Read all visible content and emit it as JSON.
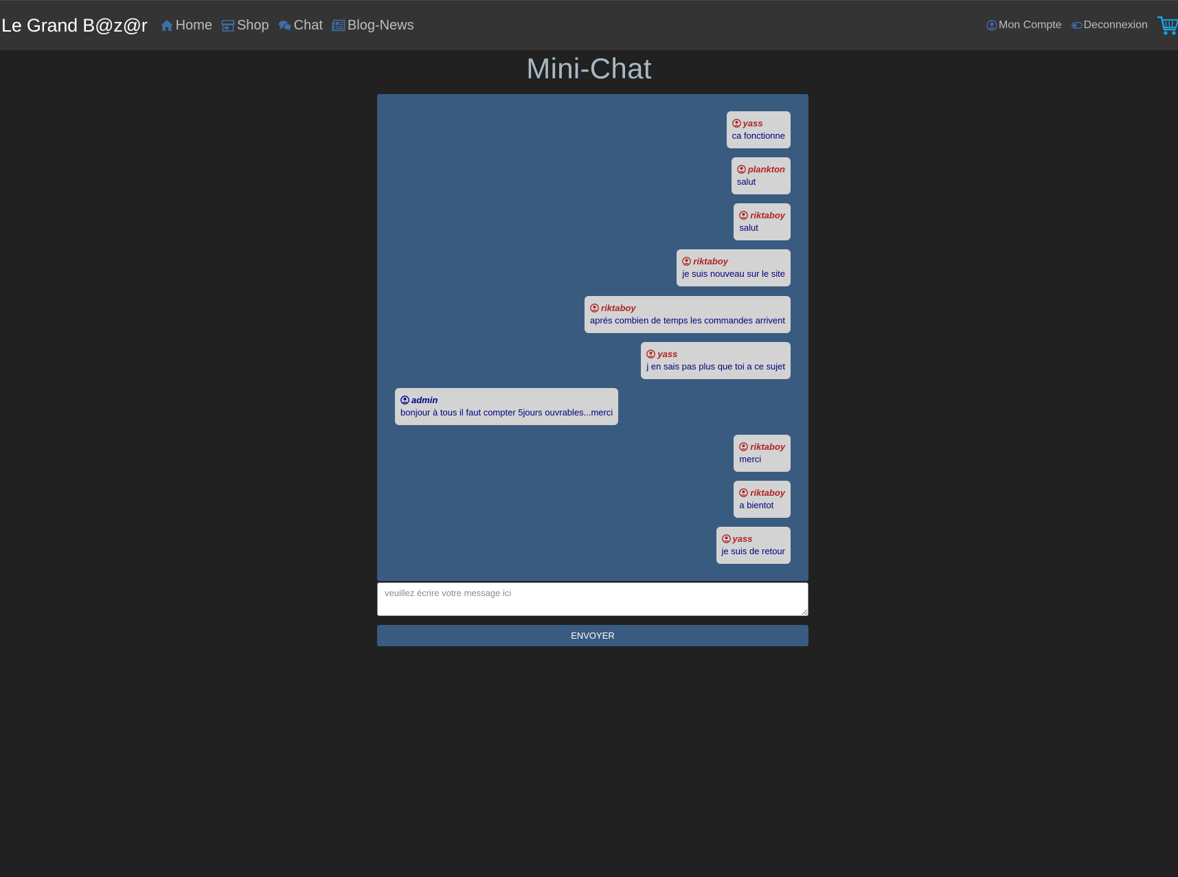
{
  "navbar": {
    "brand": "Le Grand B@z@r",
    "links": [
      {
        "label": "Home",
        "icon": "home-icon"
      },
      {
        "label": "Shop",
        "icon": "store-icon"
      },
      {
        "label": "Chat",
        "icon": "comments-icon"
      },
      {
        "label": "Blog-News",
        "icon": "newspaper-icon"
      }
    ],
    "account_label": "Mon Compte",
    "logout_label": "Deconnexion",
    "cart_icon": "cart-icon"
  },
  "page": {
    "title": "Mini-Chat"
  },
  "messages": [
    {
      "user": "yass",
      "text": "ca fonctionne",
      "side": "right"
    },
    {
      "user": "plankton",
      "text": "salut",
      "side": "right"
    },
    {
      "user": "riktaboy",
      "text": "salut",
      "side": "right"
    },
    {
      "user": "riktaboy",
      "text": "je suis nouveau sur le site",
      "side": "right"
    },
    {
      "user": "riktaboy",
      "text": "aprés combien de temps les commandes arrivent",
      "side": "right"
    },
    {
      "user": "yass",
      "text": "j en sais pas plus que toi a ce sujet",
      "side": "right"
    },
    {
      "user": "admin",
      "text": "bonjour à tous il faut compter 5jours ouvrables...merci",
      "side": "left"
    },
    {
      "user": "riktaboy",
      "text": "merci",
      "side": "right"
    },
    {
      "user": "riktaboy",
      "text": "a bientot",
      "side": "right"
    },
    {
      "user": "yass",
      "text": "je suis de retour",
      "side": "right"
    }
  ],
  "composer": {
    "placeholder": "veuillez écrire votre message ici",
    "value": "",
    "send_label": "ENVOYER"
  },
  "colors": {
    "background": "#212121",
    "navbar": "#343434",
    "chat_panel": "#395b7f",
    "bubble": "#d3d3d3",
    "user_name": "#b22222",
    "admin_name": "#00008b",
    "message_text": "#000080",
    "icon_blue": "#3d6ea8",
    "cart_blue": "#1aa3e8"
  }
}
